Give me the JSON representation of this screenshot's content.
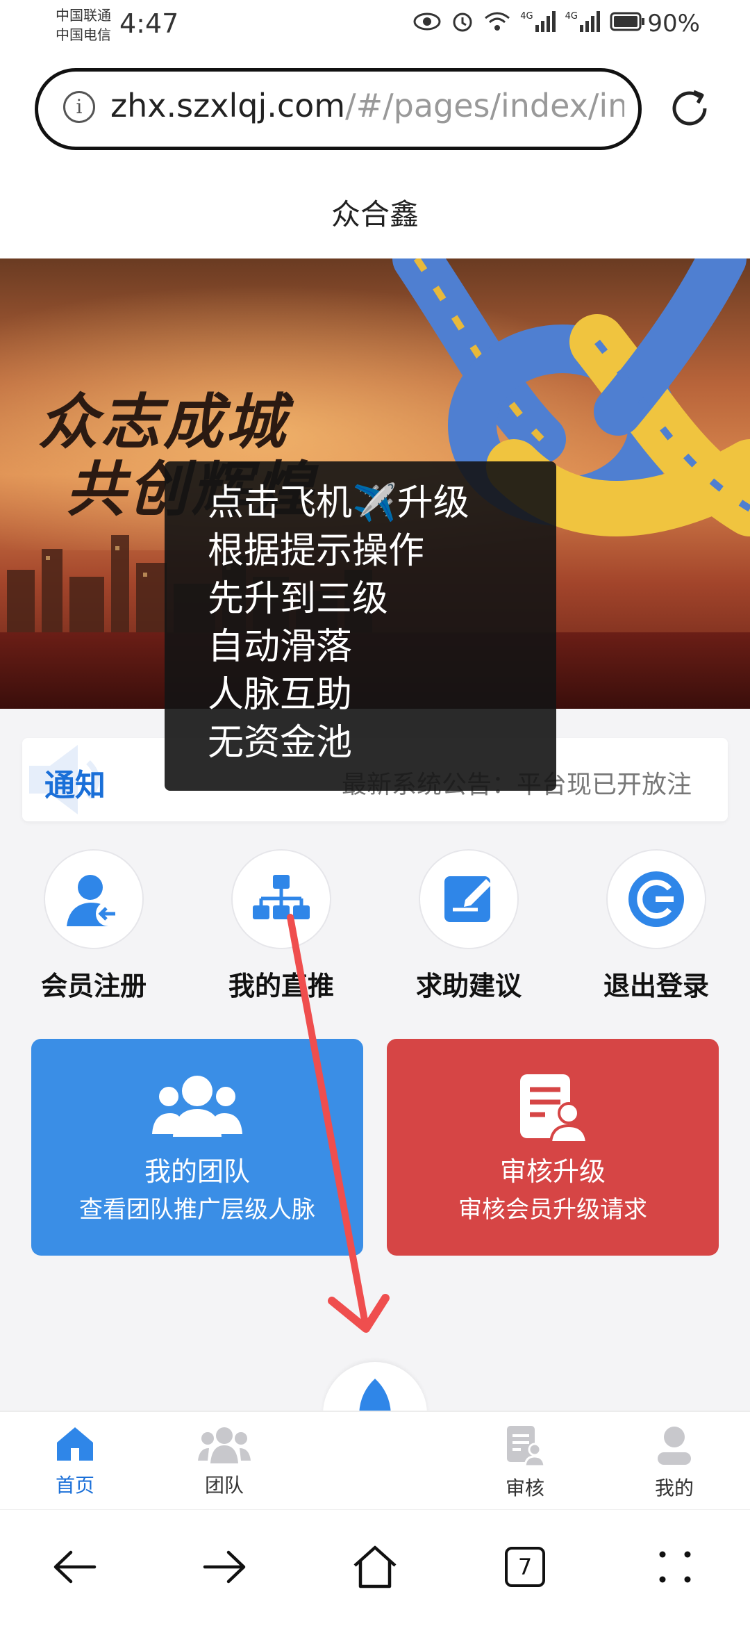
{
  "status_bar": {
    "carrier_1": "中国联通",
    "carrier_2": "中国电信",
    "time": "4:47",
    "network_1": "4G",
    "network_2": "4G",
    "battery": "90%"
  },
  "browser": {
    "url_host": "zhx.szxlqj.com",
    "url_path": "/#/pages/index/ind",
    "tab_count": "7"
  },
  "page": {
    "title": "众合鑫"
  },
  "banner": {
    "slogan_1": "众志成城",
    "slogan_2": "共创辉煌"
  },
  "tooltip": {
    "lines": [
      "点击飞机✈️升级",
      "根据提示操作",
      "先升到三级",
      "自动滑落",
      "人脉互助",
      "无资金池"
    ]
  },
  "notice": {
    "label": "通知",
    "text": "最新系统公告：平台现已开放注"
  },
  "quick_menu": [
    {
      "label": "会员注册",
      "icon": "user-enter-icon"
    },
    {
      "label": "我的直推",
      "icon": "org-chart-icon"
    },
    {
      "label": "求助建议",
      "icon": "edit-note-icon"
    },
    {
      "label": "退出登录",
      "icon": "logout-g-icon"
    }
  ],
  "cards": {
    "team": {
      "title": "我的团队",
      "subtitle": "查看团队推广层级人脉",
      "color": "#3a8ee6"
    },
    "review": {
      "title": "审核升级",
      "subtitle": "审核会员升级请求",
      "color": "#d64545"
    }
  },
  "tabbar": {
    "home": "首页",
    "team": "团队",
    "review": "审核",
    "mine": "我的",
    "active": "home",
    "accent": "#1a6fd8"
  }
}
